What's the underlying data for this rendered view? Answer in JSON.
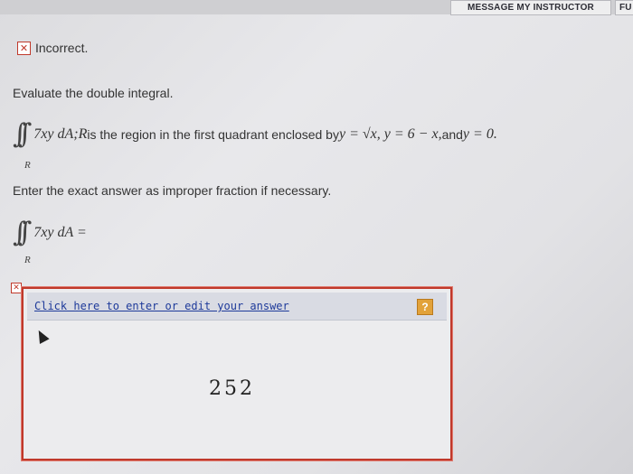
{
  "header": {
    "message_instructor": "MESSAGE MY INSTRUCTOR",
    "full_clipped": "FU"
  },
  "status": {
    "icon": "x-mark-icon",
    "text": "Incorrect."
  },
  "question": {
    "instruction": "Evaluate the double integral.",
    "integral_sign": "∫∫",
    "region_sub": "R",
    "integrand": "7xy dA",
    "separator": " ; ",
    "region_var": "R",
    "region_desc": " is the region in the first quadrant enclosed by ",
    "eq1": "y = √x,",
    "eq2": "y = 6 − x,",
    "and_text": " and ",
    "eq3": "y = 0."
  },
  "answer_prompt": {
    "instruction": "Enter the exact answer as improper fraction if necessary.",
    "integral_sign": "∫∫",
    "region_sub": "R",
    "expression": "7xy dA ="
  },
  "answer_box": {
    "edit_link": "Click here to enter or edit your answer",
    "help_label": "?",
    "value": "252",
    "mark": "✕"
  },
  "colors": {
    "error_red": "#c0392b",
    "link_blue": "#1e3a9a",
    "help_orange": "#e2a23a"
  }
}
